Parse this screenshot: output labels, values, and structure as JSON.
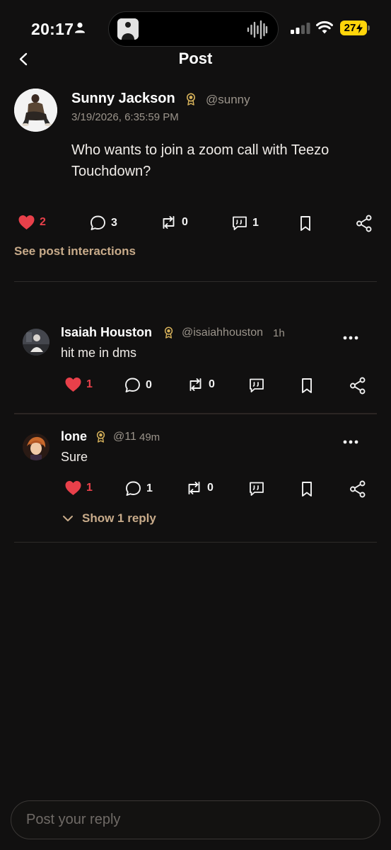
{
  "status_bar": {
    "time": "20:17",
    "battery_level": "27"
  },
  "header": {
    "title": "Post"
  },
  "post": {
    "author_name": "Sunny Jackson",
    "handle": "@sunny",
    "timestamp": "3/19/2026, 6:35:59 PM",
    "body": "Who wants to join a zoom call with Teezo Touchdown?",
    "likes": "2",
    "comments": "3",
    "reposts": "0",
    "quotes": "1",
    "interactions_link": "See post interactions"
  },
  "replies": [
    {
      "author_name": "Isaiah Houston",
      "handle": "@isaiahhouston",
      "time_ago": "1h",
      "body": "hit me in dms",
      "likes": "1",
      "comments": "0",
      "reposts": "0"
    },
    {
      "author_name": "lone",
      "handle": "@11",
      "time_ago": "49m",
      "body": "Sure",
      "likes": "1",
      "comments": "1",
      "reposts": "0",
      "show_replies_label": "Show 1 reply"
    }
  ],
  "composer": {
    "placeholder": "Post your reply"
  },
  "colors": {
    "background": "#111010",
    "accent_tan": "#c8ab8a",
    "like_red": "#e8404a",
    "muted_text": "#9b948b",
    "verified_gold": "#d6b15a"
  }
}
